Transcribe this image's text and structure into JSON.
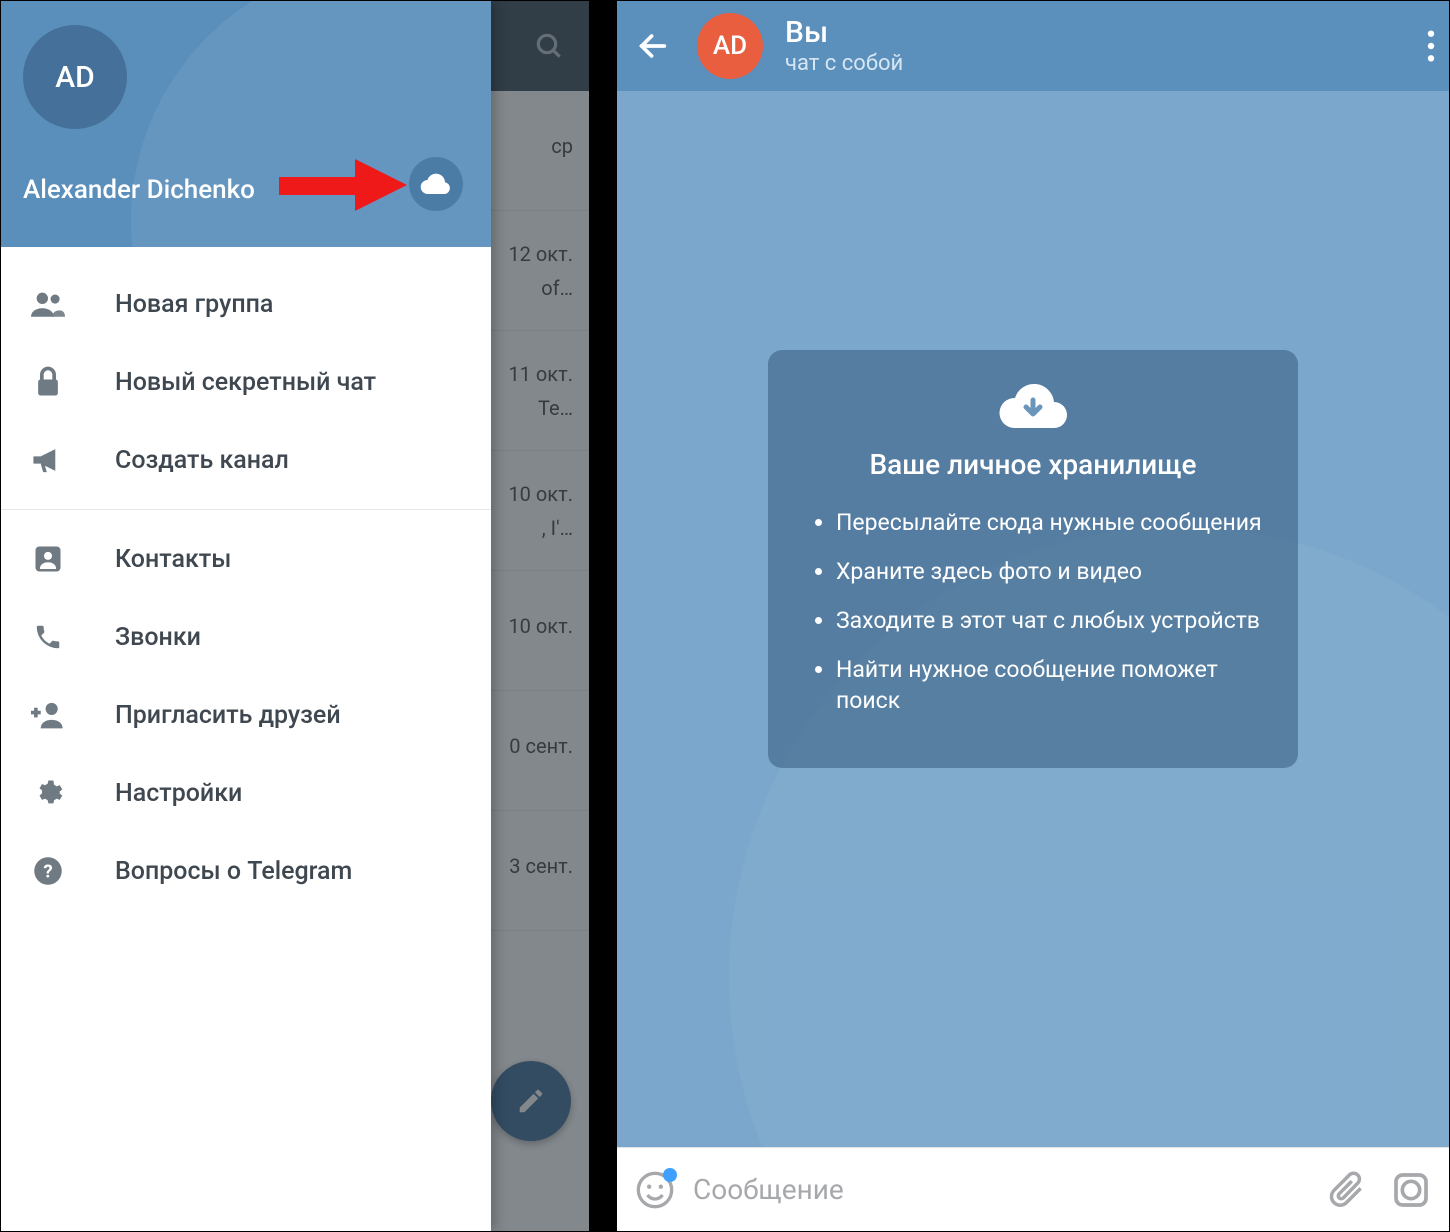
{
  "drawer": {
    "avatar_initials": "AD",
    "username": "Alexander Dichenko",
    "menu": {
      "new_group": "Новая группа",
      "new_secret": "Новый секретный чат",
      "new_channel": "Создать канал",
      "contacts": "Контакты",
      "calls": "Звонки",
      "invite": "Пригласить друзей",
      "settings": "Настройки",
      "faq": "Вопросы о Telegram"
    }
  },
  "dim_list": {
    "rows": [
      {
        "date": "ср",
        "snippet": ""
      },
      {
        "date": "12 окт.",
        "snippet": "of…"
      },
      {
        "date": "11 окт.",
        "snippet": "Te…"
      },
      {
        "date": "10 окт.",
        "snippet": ", I'…"
      },
      {
        "date": "10 окт.",
        "snippet": ""
      },
      {
        "date": "0 сент.",
        "snippet": ""
      },
      {
        "date": "3 сент.",
        "snippet": ""
      }
    ]
  },
  "chat": {
    "avatar_initials": "AD",
    "title": "Вы",
    "subtitle": "чат с собой",
    "storage_title": "Ваше личное хранилище",
    "tips": [
      "Пересылайте сюда нужные сообщения",
      "Храните здесь фото и видео",
      "Заходите в этот чат с любых устройств",
      "Найти нужное сообщение поможет поиск"
    ],
    "composer_placeholder": "Сообщение"
  },
  "colors": {
    "header_blue": "#5a8fbb",
    "body_blue": "#7aa7cb",
    "avatar_orange": "#e85e3f",
    "arrow_red": "#f01919"
  }
}
